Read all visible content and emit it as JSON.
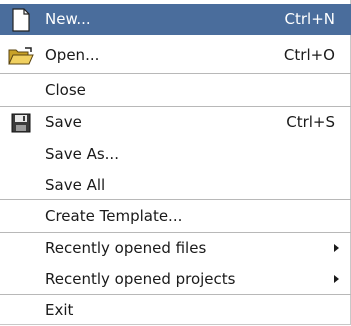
{
  "menu": {
    "items": [
      {
        "label": "New...",
        "shortcut": "Ctrl+N",
        "icon": "new-file-icon",
        "highlighted": true
      },
      {
        "label": "Open...",
        "shortcut": "Ctrl+O",
        "icon": "folder-open-icon"
      },
      {
        "label": "Close"
      },
      {
        "label": "Save",
        "shortcut": "Ctrl+S",
        "icon": "floppy-disk-icon"
      },
      {
        "label": "Save As..."
      },
      {
        "label": "Save All"
      },
      {
        "label": "Create Template..."
      },
      {
        "label": "Recently opened files",
        "submenu": true
      },
      {
        "label": "Recently opened projects",
        "submenu": true
      },
      {
        "label": "Exit"
      }
    ]
  },
  "colors": {
    "highlight": "#4a6d9c",
    "separator": "#b8b8b8"
  }
}
